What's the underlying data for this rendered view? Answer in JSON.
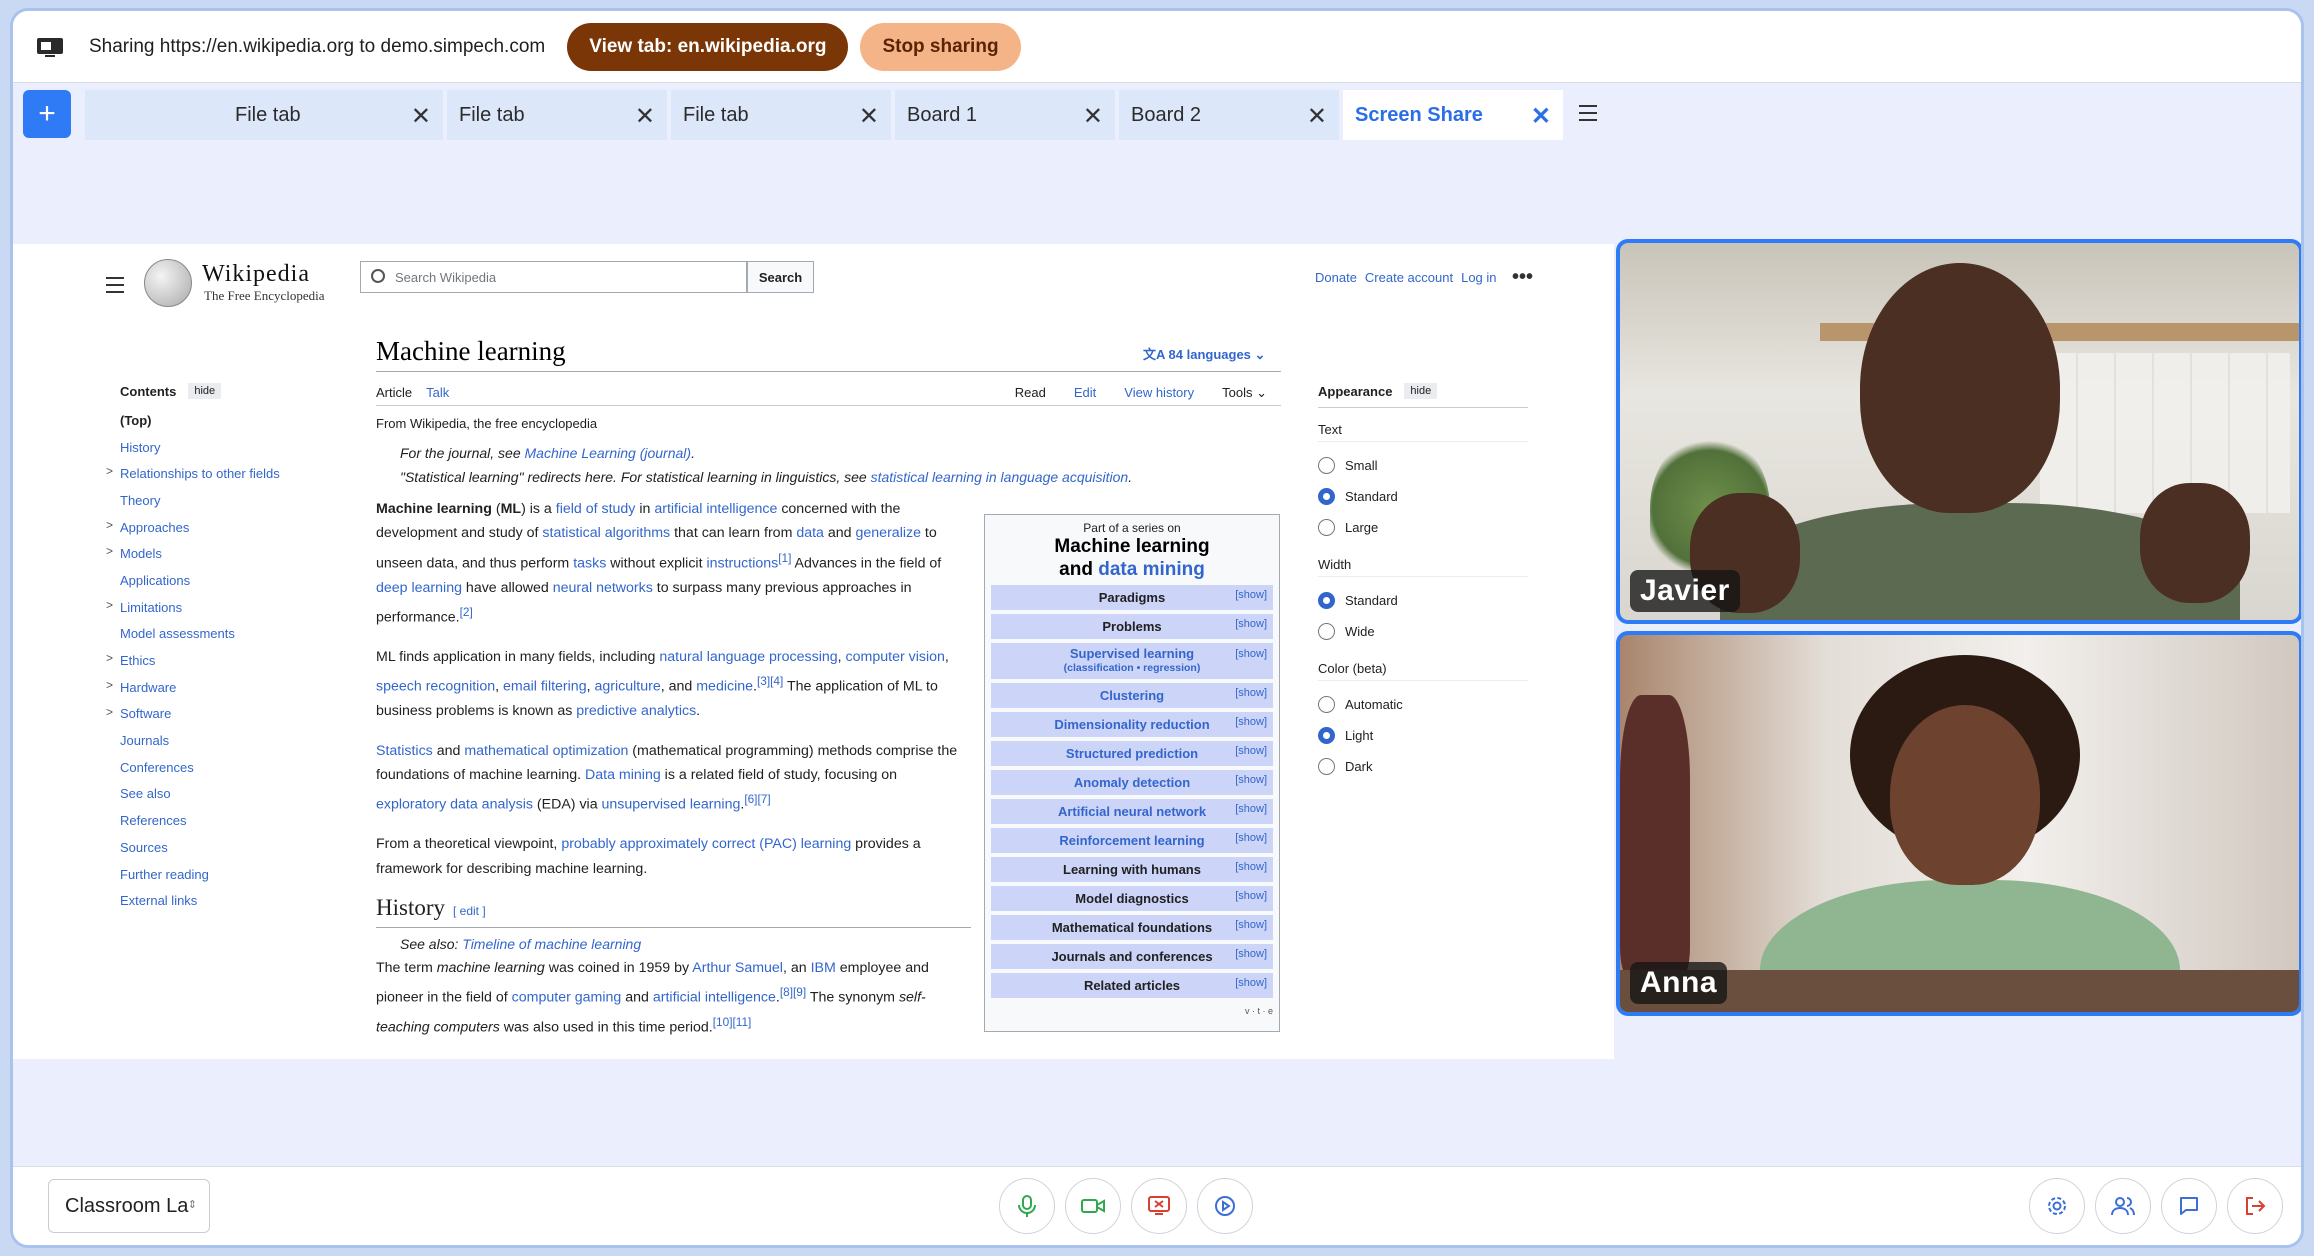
{
  "sharebar": {
    "text": "Sharing https://en.wikipedia.org to demo.simpech.com",
    "view_tab": "View tab: en.wikipedia.org",
    "stop": "Stop sharing"
  },
  "tabs": [
    {
      "label": ""
    },
    {
      "label": "File tab"
    },
    {
      "label": "File tab"
    },
    {
      "label": "File tab"
    },
    {
      "label": "Board 1"
    },
    {
      "label": "Board 2"
    },
    {
      "label": "Screen Share"
    }
  ],
  "add_label": "+",
  "close_glyph": "✕",
  "wiki": {
    "wordmark": "Wikipedia",
    "tagline": "The Free Encyclopedia",
    "search_placeholder": "Search Wikipedia",
    "search_button": "Search",
    "top_links": [
      "Donate",
      "Create account",
      "Log in"
    ],
    "more": "•••",
    "contents": {
      "title": "Contents",
      "hide": "hide",
      "items": [
        {
          "label": "(Top)"
        },
        {
          "label": "History"
        },
        {
          "label": "Relationships to other fields"
        },
        {
          "label": "Theory"
        },
        {
          "label": "Approaches"
        },
        {
          "label": "Models"
        },
        {
          "label": "Applications"
        },
        {
          "label": "Limitations"
        },
        {
          "label": "Model assessments"
        },
        {
          "label": "Ethics"
        },
        {
          "label": "Hardware"
        },
        {
          "label": "Software"
        },
        {
          "label": "Journals"
        },
        {
          "label": "Conferences"
        },
        {
          "label": "See also"
        },
        {
          "label": "References"
        },
        {
          "label": "Sources"
        },
        {
          "label": "Further reading"
        },
        {
          "label": "External links"
        }
      ]
    },
    "title": "Machine learning",
    "languages": "84 languages",
    "tabs_left": [
      "Article",
      "Talk"
    ],
    "tabs_right": [
      "Read",
      "Edit",
      "View history",
      "Tools"
    ],
    "from": "From Wikipedia, the free encyclopedia",
    "hat1_pre": "For the journal, see ",
    "hat1_link": "Machine Learning (journal)",
    "hat1_post": ".",
    "hat2_pre": "\"Statistical learning\" redirects here. For statistical learning in linguistics, see ",
    "hat2_link": "statistical learning in language acquisition",
    "hat2_post": ".",
    "p1": {
      "a": "Machine learning",
      "b": " (",
      "c": "ML",
      "d": ") is a ",
      "l1": "field of study",
      "e": " in ",
      "l2": "artificial intelligence",
      "f": " concerned with the development and study of ",
      "l3": "statistical algorithms",
      "g": " that can learn from ",
      "l4": "data",
      "h": " and ",
      "l5": "generalize",
      "i": " to unseen data, and thus perform ",
      "l6": "tasks",
      "j": " without explicit ",
      "l7": "instructions",
      "r1": "[1]",
      "k": " Advances in the field of ",
      "l8": "deep learning",
      "m": " have allowed ",
      "l9": "neural networks",
      "n": " to surpass many previous approaches in performance.",
      "r2": "[2]"
    },
    "p2": {
      "a": "ML finds application in many fields, including ",
      "l1": "natural language processing",
      "b": ", ",
      "l2": "computer vision",
      "c": ", ",
      "l3": "speech recognition",
      "d": ", ",
      "l4": "email filtering",
      "e": ", ",
      "l5": "agriculture",
      "f": ", and ",
      "l6": "medicine",
      "g": ".",
      "r": "[3][4]",
      "h": " The application of ML to business problems is known as ",
      "l7": "predictive analytics",
      "i": "."
    },
    "p3": {
      "l1": "Statistics",
      "a": " and ",
      "l2": "mathematical optimization",
      "b": " (mathematical programming) methods comprise the foundations of machine learning. ",
      "l3": "Data mining",
      "c": " is a related field of study, focusing on ",
      "l4": "exploratory data analysis",
      "d": " (EDA) via ",
      "l5": "unsupervised learning",
      "e": ".",
      "r": "[6][7]"
    },
    "p4": {
      "a": "From a theoretical viewpoint, ",
      "l1": "probably approximately correct (PAC) learning",
      "b": " provides a framework for describing machine learning."
    },
    "history": {
      "title": "History",
      "edit": "[ edit ]"
    },
    "seealso_pre": "See also: ",
    "seealso_link": "Timeline of machine learning",
    "p5": {
      "a": "The term ",
      "b": "machine learning",
      "c": " was coined in 1959 by ",
      "l1": "Arthur Samuel",
      "d": ", an ",
      "l2": "IBM",
      "e": " employee and pioneer in the field of ",
      "l3": "computer gaming",
      "f": " and ",
      "l4": "artificial intelligence",
      "g": ".",
      "r1": "[8][9]",
      "h": " The synonym ",
      "i": "self-teaching computers",
      "j": " was also used in this time period.",
      "r2": "[10][11]"
    },
    "navbox": {
      "part": "Part of a series on",
      "big1": "Machine learning",
      "big2a": "and ",
      "big2b": "data mining",
      "show": "[show]",
      "vte": "v · t · e",
      "rows": [
        {
          "label": "Paradigms",
          "link": false
        },
        {
          "label": "Problems",
          "link": false
        },
        {
          "label": "Supervised learning",
          "sub": "(classification • regression)",
          "link": true
        },
        {
          "label": "Clustering",
          "link": true
        },
        {
          "label": "Dimensionality reduction",
          "link": true
        },
        {
          "label": "Structured prediction",
          "link": true
        },
        {
          "label": "Anomaly detection",
          "link": true
        },
        {
          "label": "Artificial neural network",
          "link": true
        },
        {
          "label": "Reinforcement learning",
          "link": true
        },
        {
          "label": "Learning with humans",
          "link": false
        },
        {
          "label": "Model diagnostics",
          "link": false
        },
        {
          "label": "Mathematical foundations",
          "link": false
        },
        {
          "label": "Journals and conferences",
          "link": false
        },
        {
          "label": "Related articles",
          "link": false
        }
      ]
    },
    "appearance": {
      "title": "Appearance",
      "hide": "hide",
      "text_label": "Text",
      "text_options": [
        "Small",
        "Standard",
        "Large"
      ],
      "text_selected": 1,
      "width_label": "Width",
      "width_options": [
        "Standard",
        "Wide"
      ],
      "width_selected": 0,
      "color_label": "Color (beta)",
      "color_options": [
        "Automatic",
        "Light",
        "Dark"
      ],
      "color_selected": 1
    }
  },
  "participants": [
    {
      "name": "Javier"
    },
    {
      "name": "Anna"
    }
  ],
  "room": {
    "value": "Classroom La"
  },
  "colors": {
    "accent": "#2f7bf5",
    "mic": "#2fa84f",
    "camera": "#2fa84f",
    "share": "#d64132",
    "record": "#3b6fd6",
    "leave": "#d64132"
  }
}
